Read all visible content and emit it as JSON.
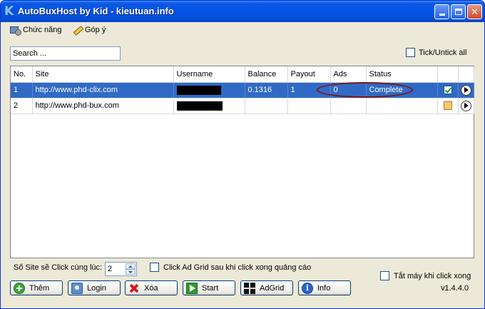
{
  "window": {
    "title": "AutoBuxHost by Kid - kieutuan.info",
    "icon": "K"
  },
  "menu": [
    {
      "label": "Chức năng",
      "icon": "function-icon"
    },
    {
      "label": "Góp ý",
      "icon": "pencil-icon"
    }
  ],
  "search": {
    "placeholder": "Search ..."
  },
  "tick_all": {
    "label": "Tick/Untick all",
    "checked": false
  },
  "table": {
    "columns": [
      "No.",
      "Site",
      "Username",
      "Balance",
      "Payout",
      "Ads",
      "Status",
      "",
      ""
    ],
    "rows": [
      {
        "no": "1",
        "site": "http://www.phd-clix.com",
        "username": "",
        "balance": "0.1316",
        "payout": "1",
        "ads": "0",
        "status": "Complete",
        "checked": true,
        "selected": true
      },
      {
        "no": "2",
        "site": "http://www.phd-bux.com",
        "username": "",
        "balance": "",
        "payout": "",
        "ads": "",
        "status": "",
        "checked": false,
        "selected": false
      }
    ]
  },
  "options": {
    "concurrent_label": "Số Site sẽ Click cùng lúc:",
    "concurrent_value": "2",
    "adgrid_label": "Click Ad Grid sau khi click xong quảng cáo",
    "shutdown_label": "Tắt máy khi click xong"
  },
  "buttons": {
    "add": "Thêm",
    "login": "Login",
    "delete": "Xóa",
    "start": "Start",
    "adgrid": "AdGrid",
    "info": "Info"
  },
  "version": "v1.4.4.0",
  "colors": {
    "titlebar": "#0553e3",
    "selection": "#316ac5",
    "annotation": "#7a1414"
  }
}
